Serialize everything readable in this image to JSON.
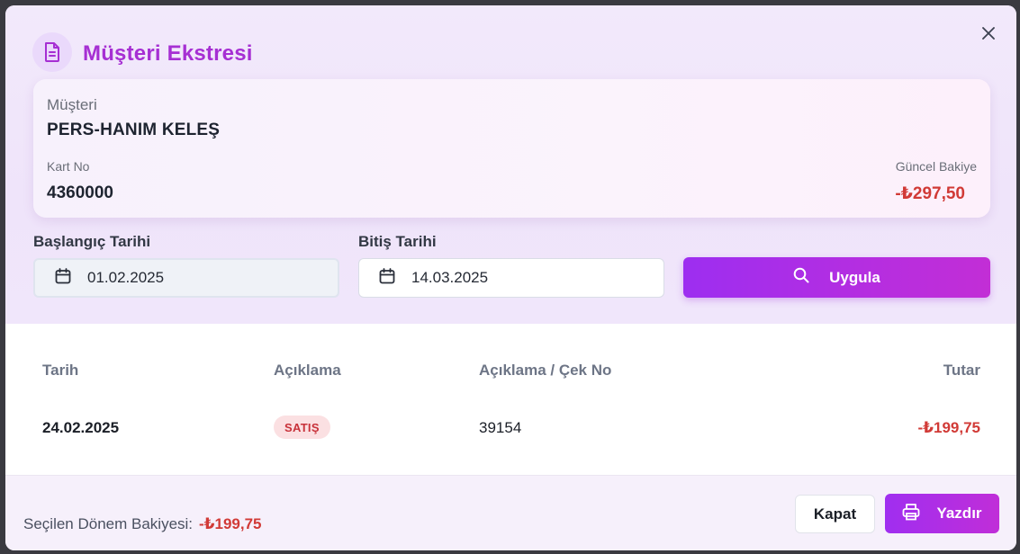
{
  "dialog": {
    "title": "Müşteri Ekstresi",
    "icon": "document-icon",
    "close_icon": "close-icon"
  },
  "customer": {
    "label": "Müşteri",
    "name": "PERS-HANIM KELEŞ",
    "card_label": "Kart No",
    "card_no": "4360000",
    "balance_label": "Güncel Bakiye",
    "balance": "-₺297,50"
  },
  "filters": {
    "start_label": "Başlangıç Tarihi",
    "start_value": "01.02.2025",
    "end_label": "Bitiş Tarihi",
    "end_value": "14.03.2025",
    "apply_label": "Uygula"
  },
  "table": {
    "columns": [
      "Tarih",
      "Açıklama",
      "Açıklama / Çek No",
      "Tutar"
    ],
    "rows": [
      {
        "date": "24.02.2025",
        "type": "SATIŞ",
        "ref": "39154",
        "amount": "-₺199,75"
      }
    ]
  },
  "footer": {
    "period_label": "Seçilen Dönem Bakiyesi:",
    "period_value": "-₺199,75",
    "close_label": "Kapat",
    "print_label": "Yazdır"
  },
  "colors": {
    "accent": "#a62fd3",
    "negative": "#d13a36"
  }
}
